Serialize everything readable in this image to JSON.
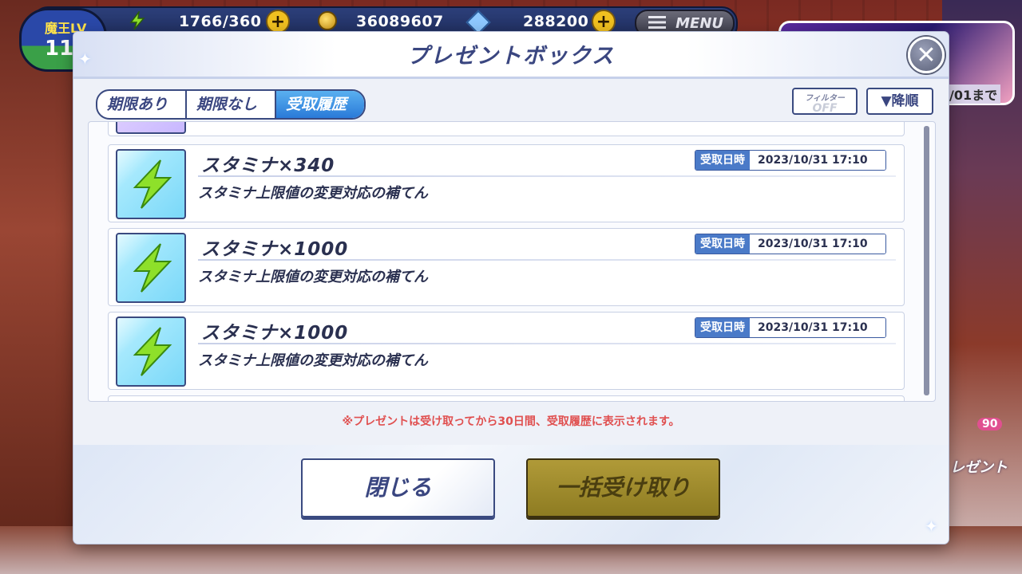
{
  "hud": {
    "level_label": "魔王LV",
    "level_value": "11",
    "stamina": "1766/360",
    "coins": "36089607",
    "gems": "288200",
    "menu_label": "MENU"
  },
  "banner": {
    "gacha_date": "/01まで"
  },
  "dialog": {
    "title": "プレゼントボックス",
    "close_glyph": "✕",
    "tabs": [
      {
        "label": "期限あり",
        "active": false
      },
      {
        "label": "期限なし",
        "active": false
      },
      {
        "label": "受取履歴",
        "active": true
      }
    ],
    "filter": {
      "label": "フィルター",
      "state": "OFF"
    },
    "sort": {
      "label": "▼降順"
    },
    "items": [
      {
        "name": "スタミナ×340",
        "description": "スタミナ上限値の変更対応の補てん",
        "received_label": "受取日時",
        "received_at": "2023/10/31 17:10",
        "icon": "stamina-bolt-icon"
      },
      {
        "name": "スタミナ×1000",
        "description": "スタミナ上限値の変更対応の補てん",
        "received_label": "受取日時",
        "received_at": "2023/10/31 17:10",
        "icon": "stamina-bolt-icon"
      },
      {
        "name": "スタミナ×1000",
        "description": "スタミナ上限値の変更対応の補てん",
        "received_label": "受取日時",
        "received_at": "2023/10/31 17:10",
        "icon": "stamina-bolt-icon"
      }
    ],
    "note": "※プレゼントは受け取ってから30日間、受取履歴に表示されます。",
    "buttons": {
      "close": "閉じる",
      "receive_all": "一括受け取り"
    }
  },
  "side": {
    "present_count": "90",
    "present_label": "レゼント"
  },
  "colors": {
    "accent": "#3a4680",
    "active_tab": "#2a7ad8",
    "stamina_icon": "#8ee02a",
    "note": "#e05050",
    "receive_all_bg": "#9e8a2c"
  }
}
